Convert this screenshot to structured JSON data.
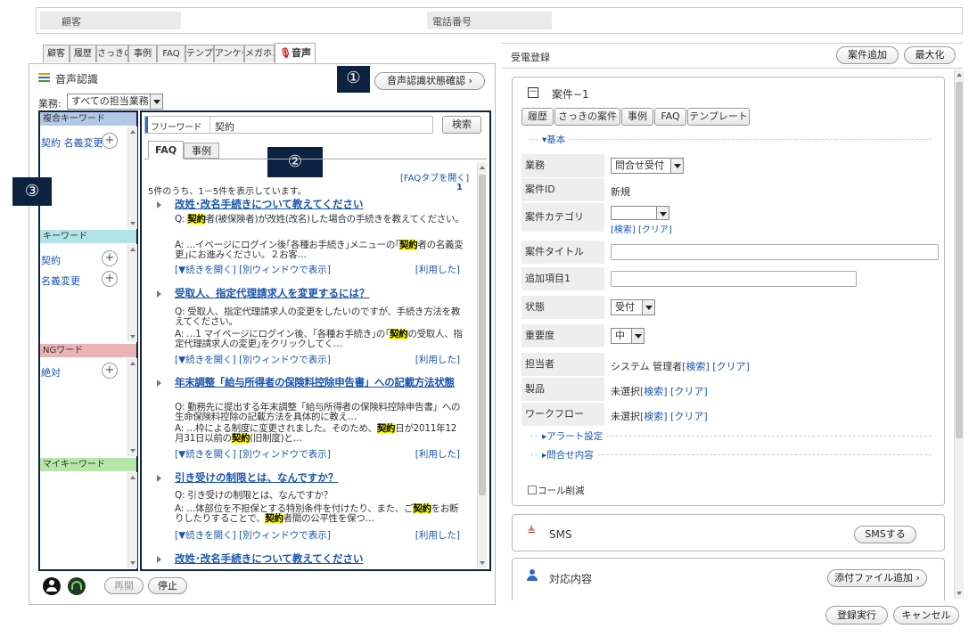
{
  "header": {
    "customer_label": "顧客",
    "phone_label": "電話番号"
  },
  "tabs": [
    "顧客",
    "履歴",
    "さっきの案件",
    "事例",
    "FAQ",
    "テンプレート",
    "アンケート",
    "メガホン",
    "音声"
  ],
  "voice": {
    "title": "音声認識",
    "status_button": "音声認識状態確認",
    "business_label": "業務:",
    "business_value": "すべての担当業務",
    "callouts": [
      "①",
      "②",
      "③"
    ],
    "keyword_groups": [
      {
        "title": "複合キーワード",
        "color": "#b3c8e6",
        "items": [
          "契約 名義変更"
        ]
      },
      {
        "title": "キーワード",
        "color": "#b2e3e6",
        "items": [
          "契約",
          "名義変更"
        ]
      },
      {
        "title": "NGワード",
        "color": "#eab4b4",
        "items": [
          "絶対"
        ]
      },
      {
        "title": "マイキーワード",
        "color": "#b7e6a8",
        "items": []
      }
    ],
    "free_word_label": "フリーワード",
    "free_word_value": "契約",
    "search_button": "検索",
    "subtabs": [
      "FAQ",
      "事例"
    ],
    "open_faq_tab": "[FAQタブを開く]",
    "result_count": "5件のうち、1－5件を表示しています。",
    "page_num": "1",
    "faq_items": [
      {
        "title": "改姓･改名手続きについて教えてください",
        "q_pre": "Q: ",
        "q_hl": "契約",
        "q_post": "者(被保険者)が改姓(改名)した場合の手続きを教えてください。",
        "a_pre": "A: …イページにログイン後｢各種お手続き｣メニューの｢",
        "a_hl": "契約",
        "a_post": "者の名義変更｣にお進みください。２お客…",
        "foot": "[▼続きを開く] [別ウィンドウで表示]",
        "used": "[利用した]"
      },
      {
        "title": "受取人、指定代理請求人を変更するには？",
        "q_pre": "Q: 受取人、指定代理請求人の変更をしたいのですが、手続き方法を教えてください。",
        "q_hl": "",
        "q_post": "",
        "a_pre": "A: …1 マイページにログイン後、｢各種お手続き｣の｢",
        "a_hl": "契約",
        "a_post": "の受取人、指定代理請求人の変更｣をクリックしてく…",
        "foot": "[▼続きを開く] [別ウィンドウで表示]",
        "used": "[利用した]"
      },
      {
        "title": "年末調整「給与所得者の保険料控除申告書」への記載方法状態",
        "q_pre": "Q: 勤務先に提出する年末調整「給与所得者の保険料控除申告書」への生命保険料控除の記載方法を具体的に教え…",
        "q_hl": "",
        "q_post": "",
        "a_pre": "A: …枠による制度に変更されました。そのため、",
        "a_hl": "契約",
        "a_post": "日が2011年12月31日以前の",
        "a_hl2": "契約",
        "a_post2": "(旧制度)と…",
        "foot": "[▼続きを開く] [別ウィンドウで表示]",
        "used": "[利用した]"
      },
      {
        "title": "引き受けの制限とは、なんですか？",
        "q_pre": "Q: 引き受けの制限とは、なんですか？",
        "q_hl": "",
        "q_post": "",
        "a_pre": "A: …体部位を不担保とする特別条件を付けたり、また、ご",
        "a_hl": "契約",
        "a_post": "をお断りしたりすることで、",
        "a_hl2": "契約",
        "a_post2": "者間の公平性を保つ…",
        "foot": "[▼続きを開く] [別ウィンドウで表示]",
        "used": "[利用した]"
      },
      {
        "title": "改姓･改名手続きについて教えてください"
      }
    ],
    "bottom": {
      "resume": "再開",
      "stop": "停止"
    }
  },
  "reception": {
    "title": "受電登録",
    "add_case": "案件追加",
    "maximize": "最大化",
    "case_name": "案件−1",
    "collapse_sign": "－",
    "case_tabs": [
      "履歴",
      "さっきの案件",
      "事例",
      "FAQ",
      "テンプレート"
    ],
    "basic_section": "▾基本",
    "fields": [
      {
        "label": "業務",
        "value": "問合せ受付",
        "type": "select"
      },
      {
        "label": "案件ID",
        "value": "新規",
        "type": "text"
      },
      {
        "label": "案件カテゴリ",
        "value": "",
        "type": "category",
        "links": "[検索] [クリア]"
      },
      {
        "label": "案件タイトル",
        "value": "",
        "type": "input"
      },
      {
        "label": "追加項目1",
        "value": "",
        "type": "input-short"
      },
      {
        "label": "状態",
        "value": "受付",
        "type": "select"
      },
      {
        "label": "重要度",
        "value": "中",
        "type": "select"
      },
      {
        "label": "担当者",
        "value": "システム 管理者",
        "type": "link",
        "links": "[検索] [クリア]"
      },
      {
        "label": "製品",
        "value": "未選択",
        "type": "link",
        "links": "[検索] [クリア]"
      },
      {
        "label": "ワークフロー",
        "value": "未選択",
        "type": "link",
        "links": "[検索] [クリア]"
      }
    ],
    "alert_section": "▸アラート設定",
    "inquiry_section": "▸問合せ内容",
    "call_cut": "コール削減",
    "sms_title": "SMS",
    "sms_button": "SMSする",
    "response_title": "対応内容",
    "attach_button": "添付ファイル追加",
    "register_button": "登録実行",
    "cancel_button": "キャンセル"
  }
}
